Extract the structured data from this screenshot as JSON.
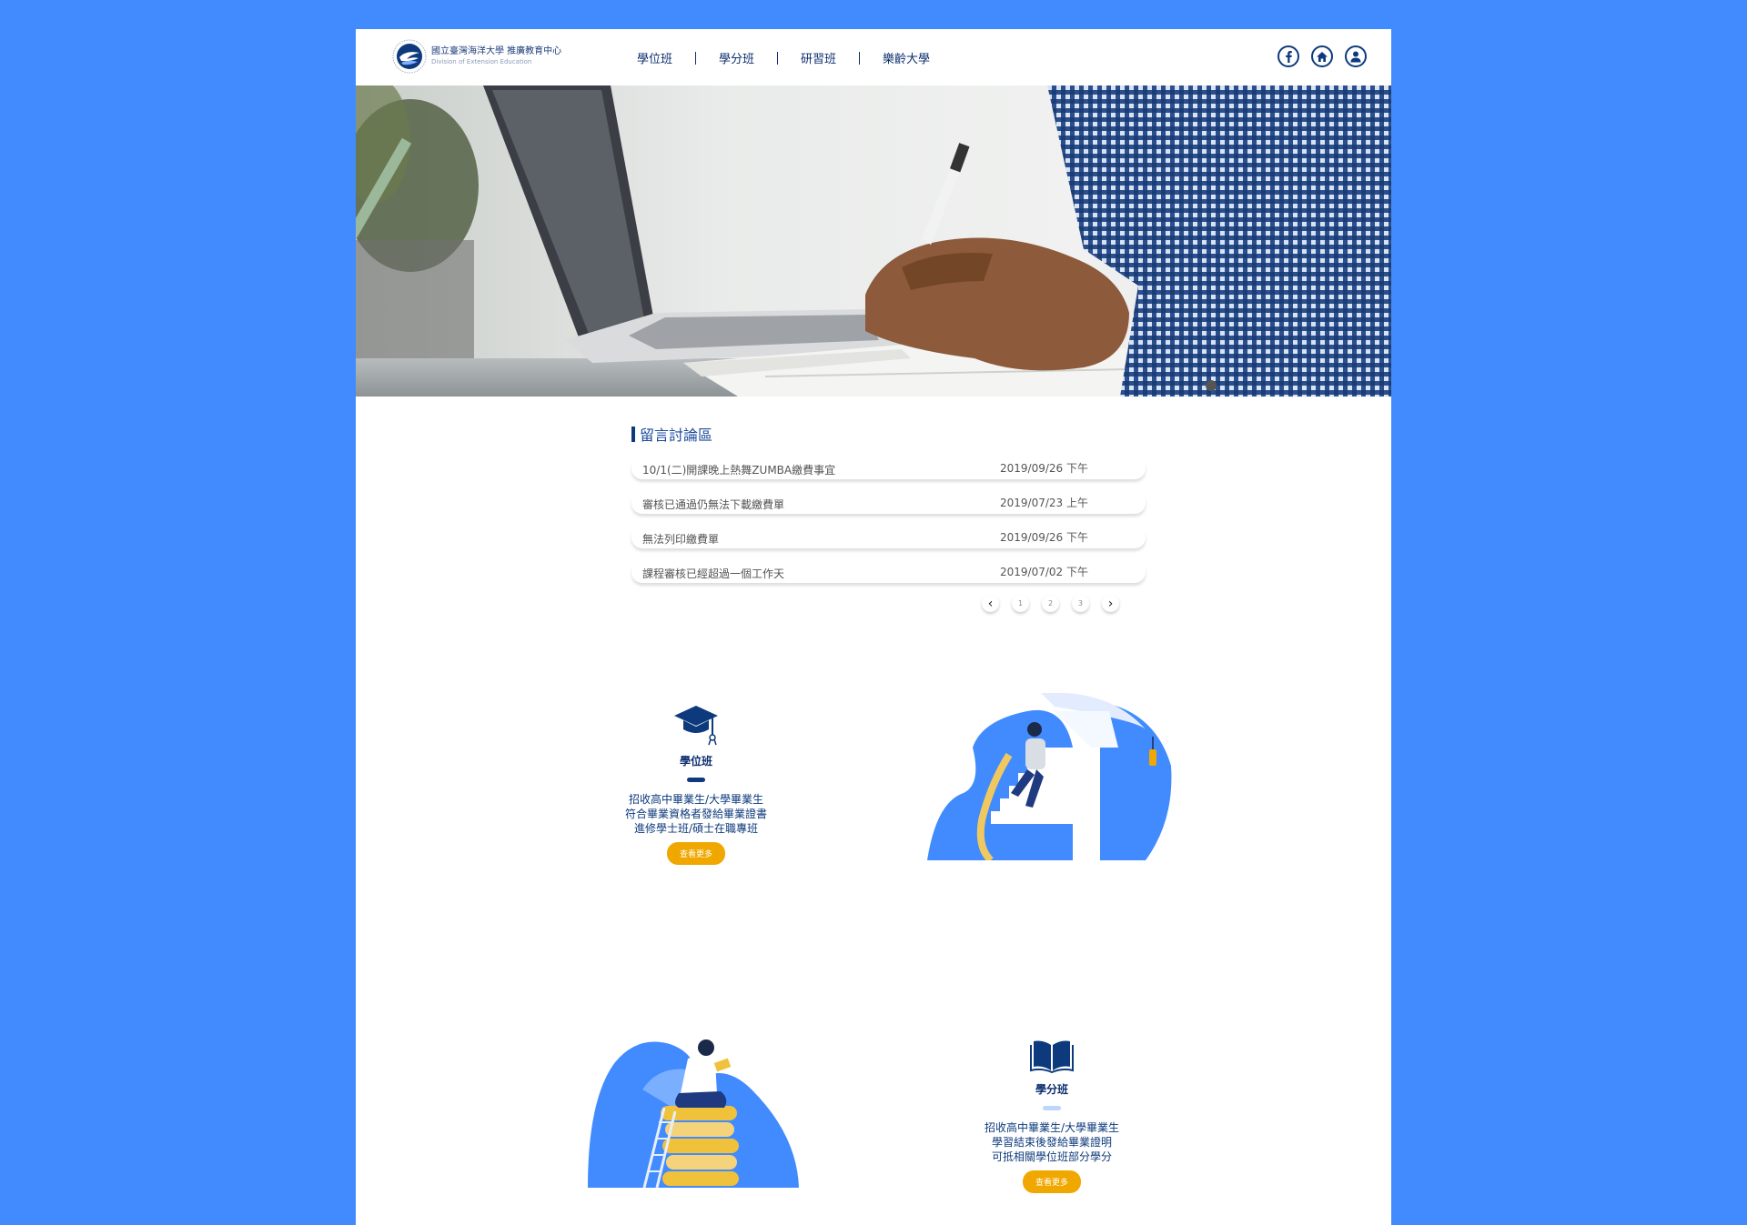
{
  "header": {
    "logo_cn": "國立臺灣海洋大學 推廣教育中心",
    "logo_en": "Division of Extension Education",
    "nav": [
      "學位班",
      "學分班",
      "研習班",
      "樂齡大學"
    ],
    "icons": [
      "facebook-icon",
      "home-icon",
      "user-icon"
    ]
  },
  "forum": {
    "title": "留言討論區",
    "rows": [
      {
        "title": "10/1(二)開課晚上熱舞ZUMBA繳費事宜",
        "date": "2019/09/26 下午"
      },
      {
        "title": "審核已通過仍無法下載繳費單",
        "date": "2019/07/23 上午"
      },
      {
        "title": "無法列印繳費單",
        "date": "2019/09/26 下午"
      },
      {
        "title": "課程審核已經超過一個工作天",
        "date": "2019/07/02 下午"
      }
    ],
    "pages": [
      "1",
      "2",
      "3"
    ],
    "prev": "‹",
    "next": "›"
  },
  "degree": {
    "title": "學位班",
    "desc": [
      "招收高中畢業生/大學畢業生",
      "符合畢業資格者發給畢業證書",
      "進修學士班/碩士在職專班"
    ],
    "button": "查看更多"
  },
  "credit": {
    "title": "學分班",
    "desc": [
      "招收高中畢業生/大學畢業生",
      "學習結束後發給畢業證明",
      "可抵相關學位班部分學分"
    ],
    "button": "查看更多"
  },
  "colors": {
    "background": "#418bff",
    "navy": "#0d3a7c",
    "button": "#f0a800",
    "bar_degree": "#0d3a7c",
    "bar_credit": "#bcd6ff"
  }
}
